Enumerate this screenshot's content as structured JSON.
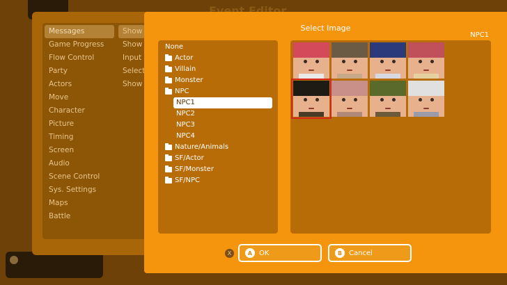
{
  "background": {
    "title": "Event Editor",
    "categories": [
      "Messages",
      "Game Progress",
      "Flow Control",
      "Party",
      "Actors",
      "Move",
      "Character",
      "Picture",
      "Timing",
      "Screen",
      "Audio",
      "Scene Control",
      "Sys. Settings",
      "Maps",
      "Battle"
    ],
    "commands": [
      "Show",
      "Show C",
      "Input N",
      "Select",
      "Show S"
    ]
  },
  "dialog": {
    "title": "Select Image",
    "current": "NPC1",
    "tree": [
      {
        "label": "None",
        "folder": false,
        "sub": false
      },
      {
        "label": "Actor",
        "folder": true,
        "sub": false
      },
      {
        "label": "Villain",
        "folder": true,
        "sub": false
      },
      {
        "label": "Monster",
        "folder": true,
        "sub": false
      },
      {
        "label": "NPC",
        "folder": true,
        "sub": false
      },
      {
        "label": "NPC1",
        "folder": false,
        "sub": true,
        "selected": true
      },
      {
        "label": "NPC2",
        "folder": false,
        "sub": true
      },
      {
        "label": "NPC3",
        "folder": false,
        "sub": true
      },
      {
        "label": "NPC4",
        "folder": false,
        "sub": true
      },
      {
        "label": "Nature/Animals",
        "folder": true,
        "sub": false
      },
      {
        "label": "SF/Actor",
        "folder": true,
        "sub": false
      },
      {
        "label": "SF/Monster",
        "folder": true,
        "sub": false
      },
      {
        "label": "SF/NPC",
        "folder": true,
        "sub": false
      }
    ],
    "faces": [
      {
        "hair": "#d44a5a",
        "shirt": "#e8e8e8"
      },
      {
        "hair": "#6b5a44",
        "shirt": "#c8a888"
      },
      {
        "hair": "#2a3a7a",
        "shirt": "#d8d8e0"
      },
      {
        "hair": "#c0505a",
        "shirt": "#e6d0a0"
      },
      {
        "hair": "#1e1a14",
        "shirt": "#4a3a28",
        "selected": true
      },
      {
        "hair": "#c9908a",
        "shirt": "#b08878"
      },
      {
        "hair": "#5a6a2a",
        "shirt": "#6a5a3a"
      },
      {
        "hair": "#e0e0e0",
        "shirt": "#9a9aa8"
      }
    ],
    "x_key": "X",
    "ok": {
      "key": "A",
      "label": "OK"
    },
    "cancel": {
      "key": "B",
      "label": "Cancel"
    }
  },
  "colors": {
    "accent": "#f5940d",
    "selection": "#d12a1a"
  }
}
